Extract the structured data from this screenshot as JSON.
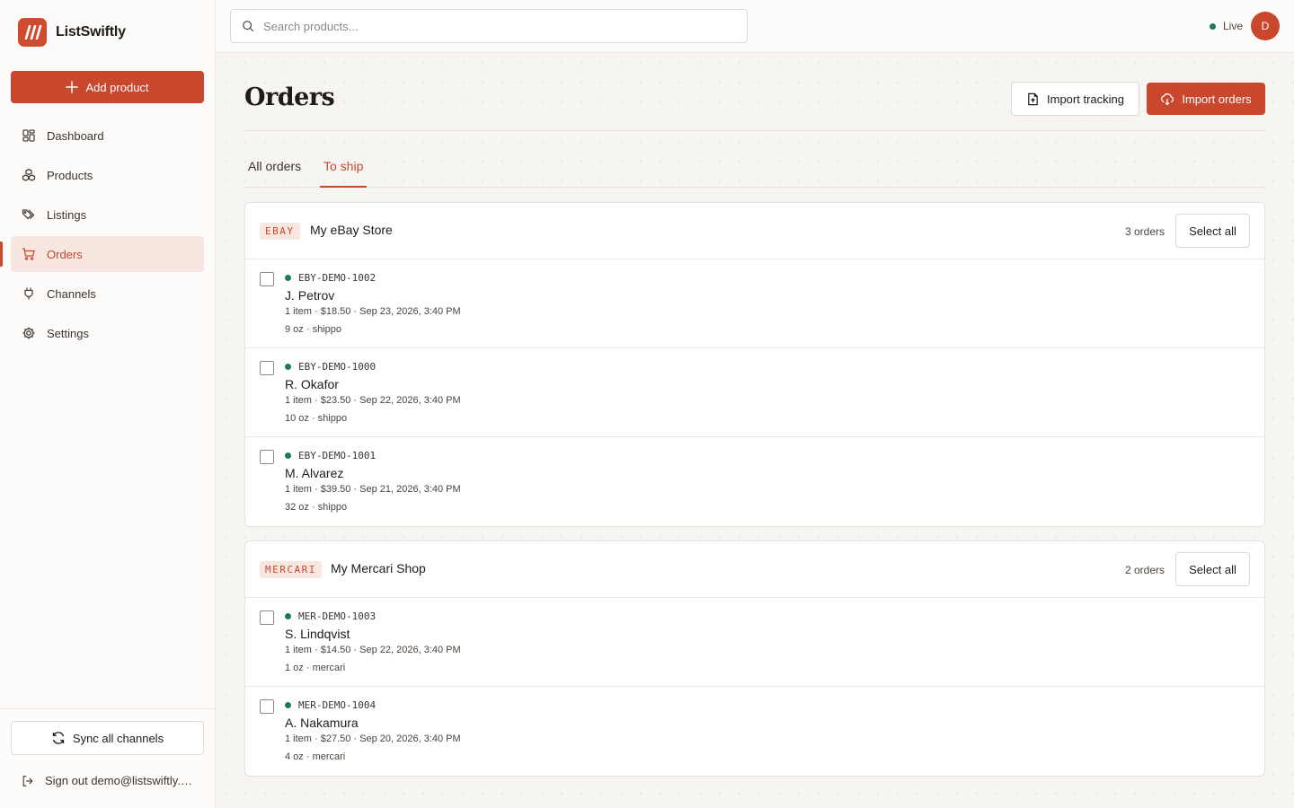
{
  "app": {
    "name": "ListSwiftly"
  },
  "sidebar": {
    "add_label": "Add product",
    "items": [
      {
        "label": "Dashboard",
        "icon": "dashboard-icon"
      },
      {
        "label": "Products",
        "icon": "boxes-icon"
      },
      {
        "label": "Listings",
        "icon": "tags-icon"
      },
      {
        "label": "Orders",
        "icon": "cart-icon",
        "active": true
      },
      {
        "label": "Channels",
        "icon": "plug-icon"
      },
      {
        "label": "Settings",
        "icon": "gear-icon"
      }
    ],
    "sync_label": "Sync all channels",
    "signout_label": "Sign out demo@listswiftly.com"
  },
  "topbar": {
    "search_placeholder": "Search products...",
    "status_label": "Live",
    "avatar_initial": "D"
  },
  "page": {
    "title": "Orders",
    "import_tracking_label": "Import tracking",
    "import_orders_label": "Import orders",
    "tabs": [
      {
        "label": "All orders"
      },
      {
        "label": "To ship",
        "active": true
      }
    ]
  },
  "groups": [
    {
      "badge": "EBAY",
      "store": "My eBay Store",
      "count": "3 orders",
      "select_label": "Select all",
      "orders": [
        {
          "id": "EBY-DEMO-1002",
          "name": "J. Petrov",
          "meta": "1 item · $18.50 · Sep 23, 2026, 3:40 PM",
          "ship": "9 oz · shippo"
        },
        {
          "id": "EBY-DEMO-1000",
          "name": "R. Okafor",
          "meta": "1 item · $23.50 · Sep 22, 2026, 3:40 PM",
          "ship": "10 oz · shippo"
        },
        {
          "id": "EBY-DEMO-1001",
          "name": "M. Alvarez",
          "meta": "1 item · $39.50 · Sep 21, 2026, 3:40 PM",
          "ship": "32 oz · shippo"
        }
      ]
    },
    {
      "badge": "MERCARI",
      "store": "My Mercari Shop",
      "count": "2 orders",
      "select_label": "Select all",
      "orders": [
        {
          "id": "MER-DEMO-1003",
          "name": "S. Lindqvist",
          "meta": "1 item · $14.50 · Sep 22, 2026, 3:40 PM",
          "ship": "1 oz · mercari"
        },
        {
          "id": "MER-DEMO-1004",
          "name": "A. Nakamura",
          "meta": "1 item · $27.50 · Sep 20, 2026, 3:40 PM",
          "ship": "4 oz · mercari"
        }
      ]
    }
  ],
  "colors": {
    "accent": "#c9472c",
    "status_live": "#1f7a5a"
  }
}
